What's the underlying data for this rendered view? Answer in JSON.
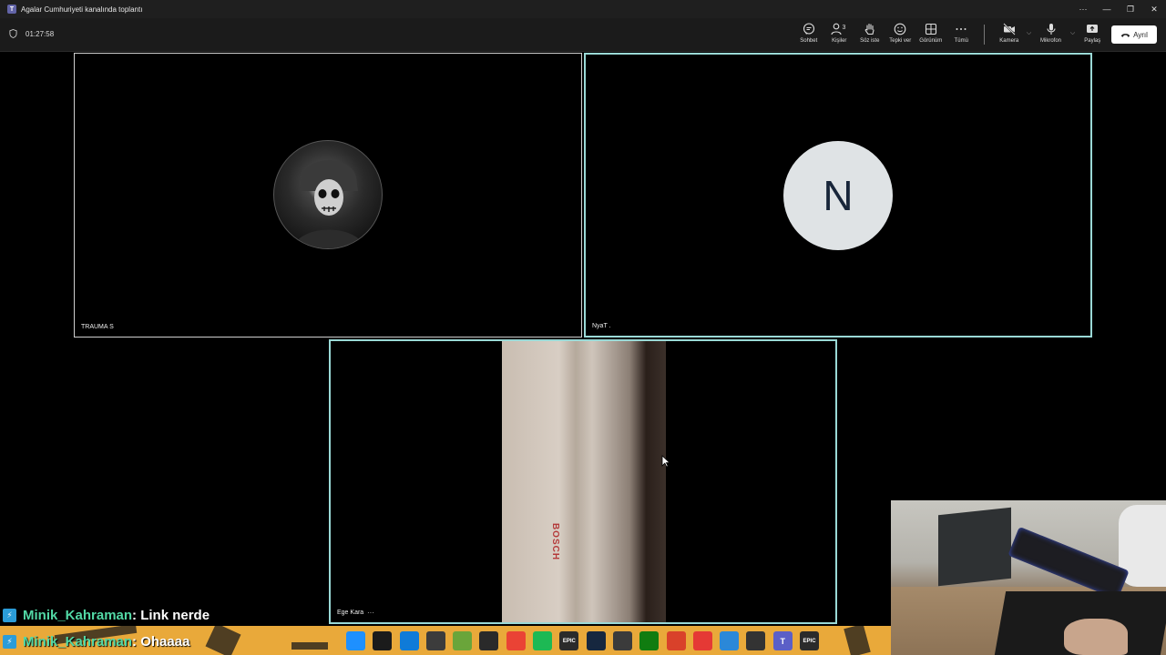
{
  "window": {
    "title": "Agalar Cumhuriyeti kanalında toplantı",
    "more": "···",
    "minimize": "—",
    "restore": "❐",
    "close": "✕"
  },
  "meeting": {
    "timer": "01:27:58",
    "people_count": "3"
  },
  "toolbar": {
    "chat": "Sohbet",
    "people": "Kişiler",
    "raise_hand": "Söz iste",
    "react": "Tepki ver",
    "view": "Görünüm",
    "more": "Tümü",
    "camera": "Kamera",
    "mic": "Mikrofon",
    "share": "Paylaş",
    "leave": "Ayrıl"
  },
  "participants": [
    {
      "name": "TRAUMA S"
    },
    {
      "name": "NyaT .",
      "initial": "N"
    },
    {
      "name": "Ege Kara",
      "more": "···",
      "video_text": "BOSCH"
    }
  ],
  "chat": [
    {
      "user": "Minik_Kahraman",
      "message": " : Link nerde"
    },
    {
      "user": "Minik_Kahraman",
      "message": " : Ohaaaa"
    }
  ],
  "taskbar": {
    "icons": [
      "windows-start-icon",
      "search-icon",
      "edge-icon",
      "nvidia-icon",
      "gamepad-icon",
      "opera-icon",
      "chrome-icon",
      "spotify-icon",
      "epic-games-icon",
      "steam-icon",
      "ubisoft-icon",
      "xbox-icon",
      "ea-icon",
      "youtube-icon",
      "settings-icon",
      "obs-icon",
      "teams-icon",
      "epic-launcher-icon"
    ],
    "labels": [
      "",
      "",
      "",
      "",
      "",
      "",
      "",
      "",
      "EPIC",
      "",
      "",
      "",
      "",
      "",
      "",
      "",
      "T",
      "EPIC"
    ],
    "colors": [
      "#1e90ff",
      "#1b1b1b",
      "#0f7bd8",
      "#3c3c3c",
      "#6aa53a",
      "#2a2a2a",
      "#ea4335",
      "#1db954",
      "#2b2b2b",
      "#16273f",
      "#3b3b3b",
      "#107c10",
      "#d9412a",
      "#e53935",
      "#2b88d8",
      "#333333",
      "#5b5fc7",
      "#2b2b2b"
    ]
  }
}
